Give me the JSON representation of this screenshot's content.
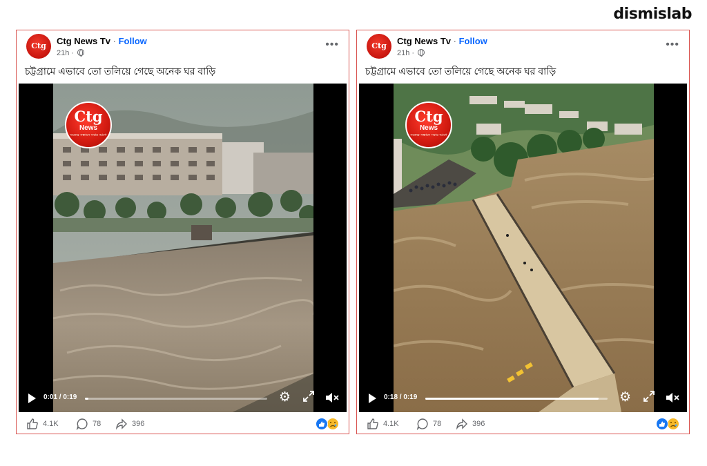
{
  "brand": "dismislab",
  "posts": [
    {
      "page_name": "Ctg News Tv",
      "separator": "·",
      "follow_label": "Follow",
      "time": "21h ·",
      "caption": "চট্টগ্রামে এভাবে তো তলিয়ে গেছে অনেক ঘর বাড়ি",
      "more_label": "•••",
      "avatar_text": "Ctg",
      "watermark": {
        "line1": "Ctg",
        "line2": "News",
        "line3": "সত্যের সন্ধানে সবার আগে"
      },
      "video_time": "0:01 / 0:19",
      "progress": 0.02,
      "likes": "4.1K",
      "comments": "78",
      "shares": "396"
    },
    {
      "page_name": "Ctg News Tv",
      "separator": "·",
      "follow_label": "Follow",
      "time": "21h ·",
      "caption": "চট্টগ্রামে এভাবে তো তলিয়ে গেছে অনেক ঘর বাড়ি",
      "more_label": "•••",
      "avatar_text": "Ctg",
      "watermark": {
        "line1": "Ctg",
        "line2": "News",
        "line3": "সত্যের সন্ধানে সবার আগে"
      },
      "video_time": "0:18 / 0:19",
      "progress": 0.95,
      "likes": "4.1K",
      "comments": "78",
      "shares": "396"
    }
  ],
  "icons": {
    "play": "play-icon",
    "settings": "gear-icon",
    "fullscreen": "expand-icon",
    "mute": "speaker-muted-icon",
    "like": "thumbs-up-icon",
    "comment": "comment-bubble-icon",
    "share": "share-arrow-icon",
    "reactions": "like-and-sad-reaction-icons"
  },
  "colors": {
    "accent": "#0866ff",
    "border": "#d9534f",
    "brand_red": "#d11a10"
  }
}
